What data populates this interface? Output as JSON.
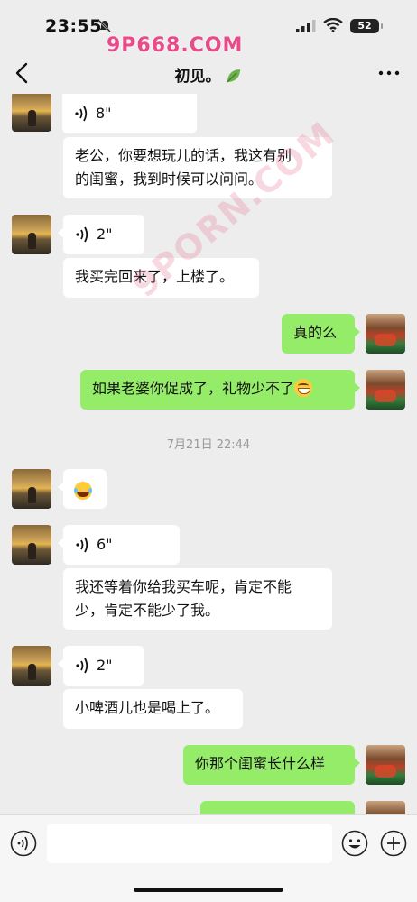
{
  "status_bar": {
    "time": "23:55",
    "battery": "52",
    "icons": [
      "bell-muted-icon",
      "signal-icon",
      "wifi-icon",
      "battery-icon"
    ]
  },
  "watermark": {
    "top": "9P668.COM",
    "diagonal": "9PORN.COM"
  },
  "navbar": {
    "title": "初见。",
    "icons": [
      "back-icon",
      "leaf-icon",
      "more-icon"
    ]
  },
  "messages": [
    {
      "side": "left",
      "type": "voice",
      "duration": "8\""
    },
    {
      "side": "left",
      "type": "text",
      "line1": "老公，你要想玩儿的话，我这有别",
      "line2": "的闺蜜，我到时候可以问问。"
    },
    {
      "side": "left",
      "type": "voice",
      "duration": "2\""
    },
    {
      "side": "left",
      "type": "text",
      "line1": "我买完回来了，上楼了。"
    },
    {
      "side": "right",
      "type": "text",
      "line1": "真的么"
    },
    {
      "side": "right",
      "type": "text",
      "line1": "如果老婆你促成了，礼物少不了",
      "emoji": "grin-emoji"
    },
    {
      "side": "center",
      "type": "timestamp",
      "line1": "7月21日 22:44"
    },
    {
      "side": "left",
      "type": "emoji",
      "emoji": "laugh-tears-emoji"
    },
    {
      "side": "left",
      "type": "voice",
      "duration": "6\""
    },
    {
      "side": "left",
      "type": "text",
      "line1": "我还等着你给我买车呢，肯定不能",
      "line2": "少，肯定不能少了我。"
    },
    {
      "side": "left",
      "type": "voice",
      "duration": "2\""
    },
    {
      "side": "left",
      "type": "text",
      "line1": "小啤酒儿也是喝上了。"
    },
    {
      "side": "right",
      "type": "text",
      "line1": "你那个闺蜜长什么样"
    },
    {
      "side": "right",
      "type": "text",
      "line1": ""
    }
  ],
  "input_bar": {
    "placeholder": "",
    "icons": [
      "voice-input-icon",
      "emoji-icon",
      "plus-icon"
    ]
  },
  "colors": {
    "background": "#ededed",
    "bubble_self": "#95ec69",
    "bubble_other": "#ffffff",
    "watermark": "#e84a8a"
  }
}
